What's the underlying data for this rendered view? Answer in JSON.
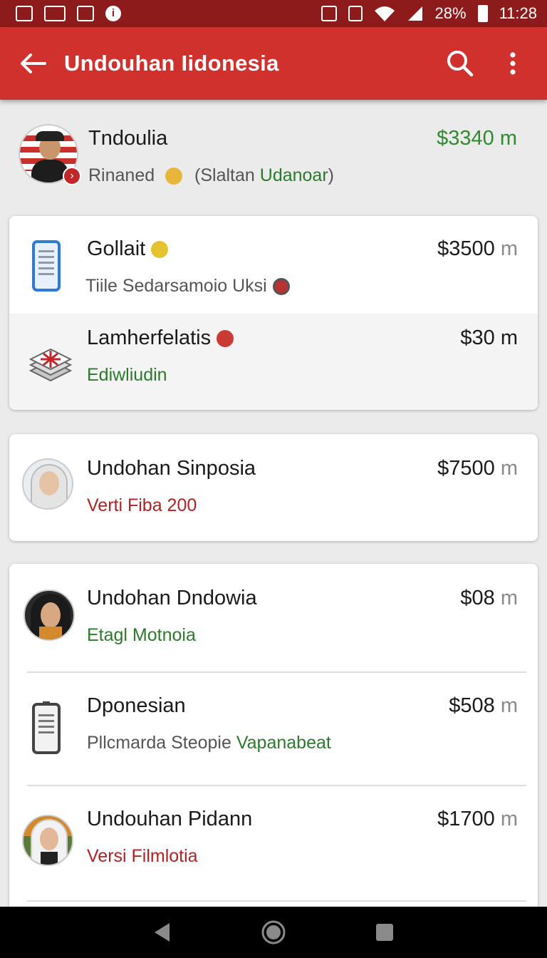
{
  "status_bar": {
    "battery": "28%",
    "time": "11:28"
  },
  "app_bar": {
    "title": "Undouhan Iidonesia"
  },
  "top_item": {
    "title": "Tndoulia",
    "price": "$3340 m",
    "subtitle_prefix": "Rinaned",
    "subtitle_paren_open": "(Slaltan ",
    "subtitle_highlight": "Udanoar",
    "subtitle_paren_close": ")"
  },
  "card1": [
    {
      "title": "Gollait",
      "price": "$3500",
      "unit": "m",
      "subtitle": "Tiile Sedarsamoio Uksi",
      "icon": "phone-icon"
    },
    {
      "title": "Lamherfelatis",
      "price": "$30",
      "unit": "m",
      "subtitle": "Ediwliudin",
      "icon": "stack-icon"
    }
  ],
  "card2": [
    {
      "title": "Undohan Sinposia",
      "price": "$7500",
      "unit": "m",
      "subtitle": "Verti Fiba 200",
      "icon": "avatar"
    }
  ],
  "card3": [
    {
      "title": "Undohan Dndowia",
      "price": "$08",
      "unit": "m",
      "subtitle": "Etagl Motnoia",
      "icon": "avatar"
    },
    {
      "title": "Dponesian",
      "price": "$508",
      "unit": "m",
      "subtitle_prefix": "Pllcmarda Steopie ",
      "subtitle_highlight": "Vapanabeat",
      "icon": "phone-icon"
    },
    {
      "title": "Undouhan Pidann",
      "price": "$1700",
      "unit": "m",
      "subtitle": "Versi Filmlotia",
      "icon": "avatar"
    }
  ],
  "colors": {
    "app_bar": "#d0312d",
    "status_bar": "#8e1b1b",
    "green_text": "#2c7a2c",
    "red_text": "#b22222",
    "price_green": "#2e8b2e"
  }
}
